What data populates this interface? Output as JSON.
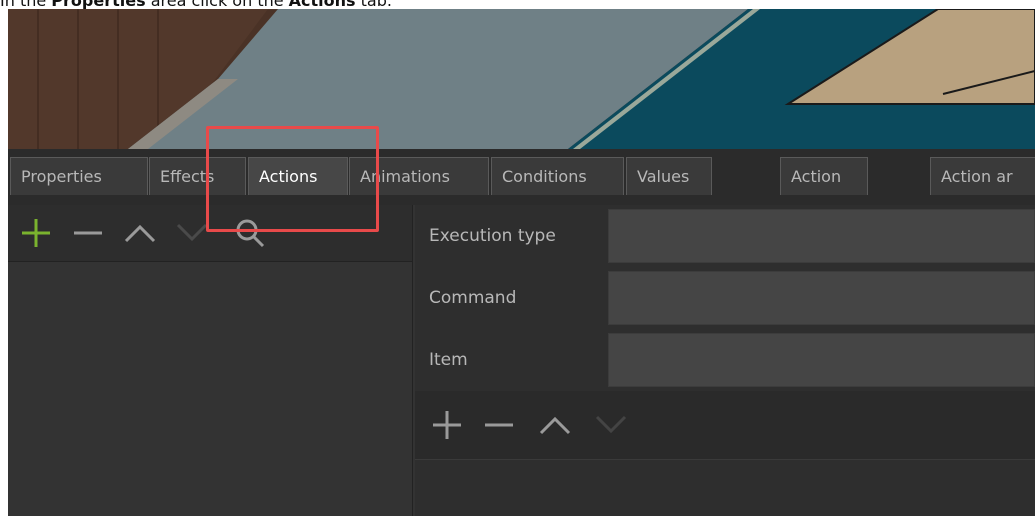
{
  "instruction": {
    "prefix": "In the ",
    "bold1": "Properties",
    "middle": " area click on the ",
    "bold2": "Actions",
    "suffix": " tab."
  },
  "tabs": [
    {
      "label": "Properties",
      "active": false
    },
    {
      "label": "Effects",
      "active": false
    },
    {
      "label": "Actions",
      "active": true
    },
    {
      "label": "Animations",
      "active": false
    },
    {
      "label": "Conditions",
      "active": false
    },
    {
      "label": "Values",
      "active": false
    },
    {
      "label": "Action",
      "active": false
    },
    {
      "label": "Action ar",
      "active": false
    }
  ],
  "left_toolbar": {
    "icons": [
      "add-icon",
      "remove-icon",
      "move-up-icon",
      "move-down-icon",
      "search-icon"
    ]
  },
  "properties_form": {
    "rows": [
      {
        "label": "Execution type",
        "value": ""
      },
      {
        "label": "Command",
        "value": ""
      },
      {
        "label": "Item",
        "value": ""
      }
    ]
  },
  "right_toolbar": {
    "icons": [
      "add-icon",
      "remove-icon",
      "move-up-icon",
      "move-down-icon"
    ]
  },
  "colors": {
    "highlight": "#e84a4a",
    "add_accent": "#7ab32e",
    "active_tab_bg": "#474747"
  }
}
